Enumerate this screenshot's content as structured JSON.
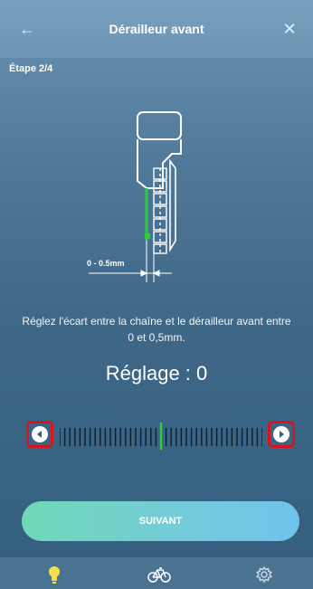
{
  "header": {
    "title": "Dérailleur avant",
    "back_icon": "arrow-left-icon",
    "close_icon": "close-icon"
  },
  "step_label": "Étape 2/4",
  "diagram": {
    "gap_label": "0 - 0.5mm",
    "indicator_color": "#2ecc40"
  },
  "instruction": "Réglez l'écart entre la chaîne et le dérailleur avant entre 0 et 0,5mm.",
  "setting": {
    "label": "Réglage : 0",
    "value": 0
  },
  "slider": {
    "decrease_icon": "caret-left-icon",
    "increase_icon": "caret-right-icon",
    "highlight_color": "#d8141c",
    "indicator_color": "#2ecc40"
  },
  "next_button": {
    "label": "SUIVANT"
  },
  "tabs": [
    {
      "name": "tips",
      "icon": "lightbulb-icon",
      "active": true,
      "color": "#f5e14a"
    },
    {
      "name": "bike",
      "icon": "bicycle-icon",
      "active": false
    },
    {
      "name": "settings",
      "icon": "gear-icon",
      "active": false
    }
  ]
}
